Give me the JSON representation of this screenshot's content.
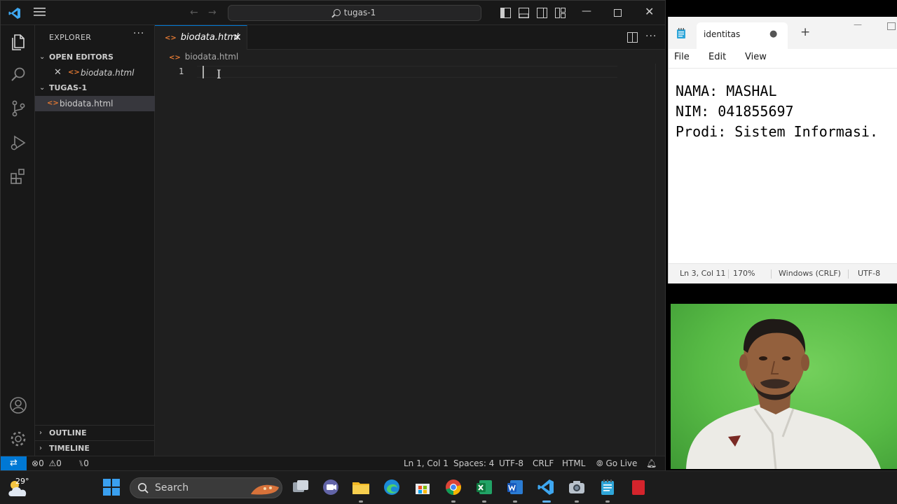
{
  "vscode": {
    "title": "tugas-1",
    "explorer_title": "EXPLORER",
    "open_editors_label": "OPEN EDITORS",
    "open_editor_file": "biodata.html",
    "folder_label": "TUGAS-1",
    "folder_file": "biodata.html",
    "outline_label": "OUTLINE",
    "timeline_label": "TIMELINE",
    "tab_label": "biodata.html",
    "breadcrumb": "biodata.html",
    "line_number": "1",
    "status": {
      "errors": "0",
      "warnings": "0",
      "ports": "0",
      "position": "Ln 1, Col 1",
      "spaces": "Spaces: 4",
      "encoding": "UTF-8",
      "eol": "CRLF",
      "language": "HTML",
      "golive": "Go Live"
    }
  },
  "notepad": {
    "tab_title": "identitas",
    "menu": {
      "file": "File",
      "edit": "Edit",
      "view": "View"
    },
    "lines": [
      "NAMA: MASHAL",
      "NIM: 041855697",
      "Prodi: Sistem Informasi."
    ],
    "status": {
      "position": "Ln 3, Col 11",
      "zoom": "170%",
      "eol": "Windows (CRLF)",
      "encoding": "UTF-8"
    }
  },
  "taskbar": {
    "temperature": "29°",
    "search_label": "Search"
  },
  "colors": {
    "vscode_accent": "#0078d4",
    "html_icon": "#e37933",
    "webcam_wall": "#55b849"
  }
}
